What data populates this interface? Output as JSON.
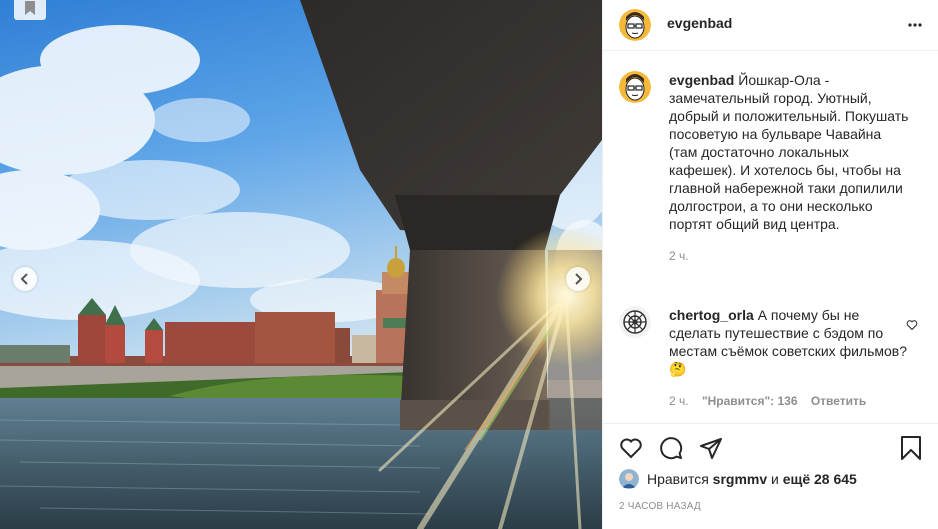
{
  "post": {
    "username": "evgenbad",
    "caption": "Йошкар-Ола - замечательный город. Уютный, добрый и положительный. Покушать посоветую на бульваре Чавайна (там достаточно локальных кафешек). И хотелось бы, чтобы на главной набережной таки допилили долгострои, а то они несколько портят общий вид центра.",
    "caption_time": "2 ч.",
    "timestamp": "2 ЧАСОВ НАЗАД"
  },
  "comment": {
    "username": "chertog_orla",
    "text": "А почему бы не сделать путешествие с бэдом по местам съёмок советских фильмов?🤔",
    "time": "2 ч.",
    "likes_label": "\"Нравится\": 136",
    "reply_label": "Ответить"
  },
  "likes": {
    "prefix": "Нравится",
    "user": "srgmmv",
    "middle": "и",
    "rest": "ещё 28 645"
  },
  "icons": {
    "save": "bookmark-icon",
    "prev": "chevron-left-icon",
    "next": "chevron-right-icon",
    "more": "more-horizontal-icon",
    "like": "heart-icon",
    "comment": "comment-icon",
    "share": "send-icon",
    "bookmark": "bookmark-outline-icon"
  }
}
